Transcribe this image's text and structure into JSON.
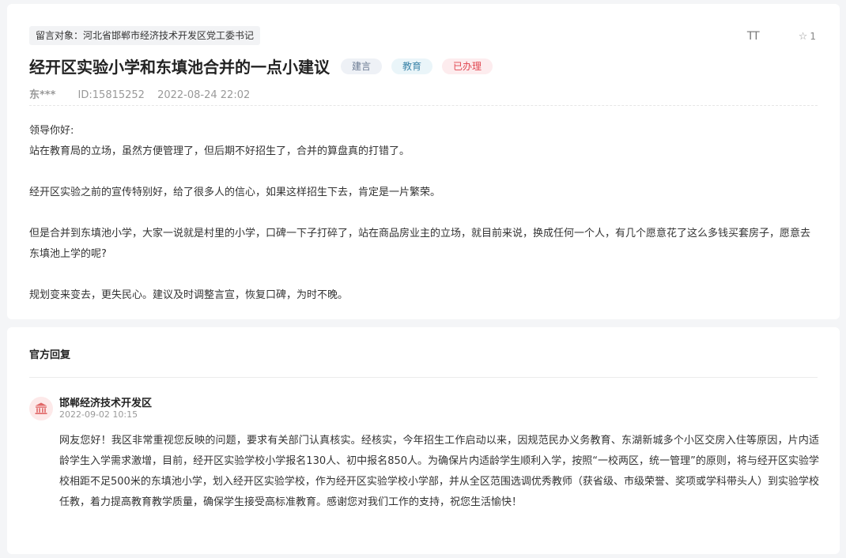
{
  "post": {
    "recipient": "留言对象：河北省邯郸市经济技术开发区党工委书记",
    "title": "经开区实验小学和东填池合并的一点小建议",
    "tags": [
      "建言",
      "教育",
      "已办理"
    ],
    "author": "东***",
    "id": "ID:15815252",
    "datetime": "2022-08-24 22:02",
    "font_size_label": "TT",
    "star_count": "1",
    "paragraphs": [
      "领导你好:",
      "站在教育局的立场，虽然方便管理了，但后期不好招生了，合并的算盘真的打错了。",
      "",
      "经开区实验之前的宣传特别好，给了很多人的信心，如果这样招生下去，肯定是一片繁荣。",
      "",
      "但是合并到东填池小学，大家一说就是村里的小学，口碑一下子打碎了，站在商品房业主的立场，就目前来说，换成任何一个人，有几个愿意花了这么多钱买套房子，愿意去东填池上学的呢?",
      "",
      "规划变来变去，更失民心。建议及时调整言宣，恢复口碑，为时不晚。"
    ]
  },
  "reply": {
    "heading": "官方回复",
    "org_name": "邯郸经济技术开发区",
    "date": "2022-09-02 10:15",
    "text": "网友您好！我区非常重视您反映的问题，要求有关部门认真核实。经核实，今年招生工作启动以来，因规范民办义务教育、东湖新城多个小区交房入住等原因，片内适龄学生入学需求激增，目前，经开区实验学校小学报名130人、初中报名850人。为确保片内适龄学生顺利入学，按照“一校两区，统一管理”的原则，将与经开区实验学校相距不足500米的东填池小学，划入经开区实验学校，作为经开区实验学校小学部，并从全区范围选调优秀教师（获省级、市级荣誉、奖项或学科带头人）到实验学校任教，着力提高教育教学质量，确保学生接受高标准教育。感谢您对我们工作的支持，祝您生活愉快！"
  },
  "colors": {
    "background": "#f4f5f7",
    "tag_suggestion": "#6a7a92",
    "tag_education": "#3b84a8",
    "tag_processed": "#e0454f",
    "avatar_bg": "#fde9e9",
    "avatar_icon": "#e06666"
  },
  "icons": {
    "font_size": "font-size-icon",
    "star": "star-icon",
    "org": "government-building-icon"
  }
}
